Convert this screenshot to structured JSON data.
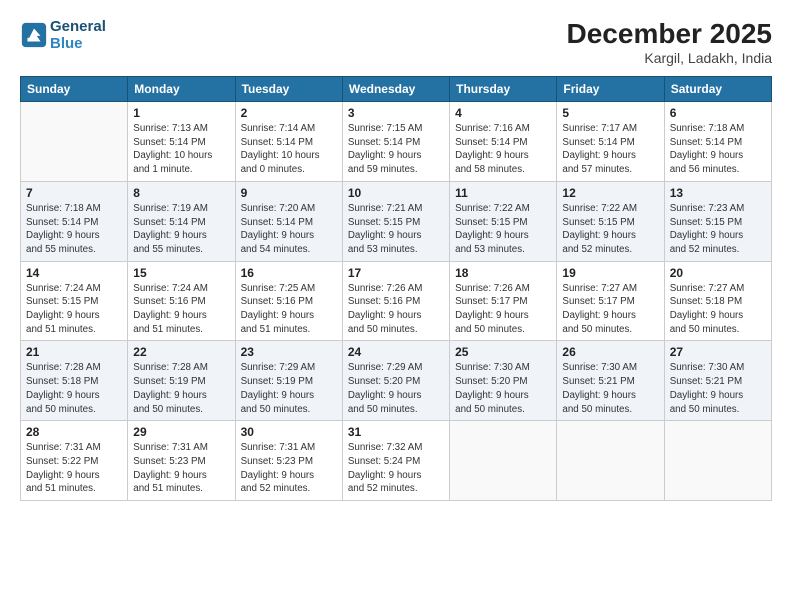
{
  "header": {
    "logo_line1": "General",
    "logo_line2": "Blue",
    "month_title": "December 2025",
    "location": "Kargil, Ladakh, India"
  },
  "weekdays": [
    "Sunday",
    "Monday",
    "Tuesday",
    "Wednesday",
    "Thursday",
    "Friday",
    "Saturday"
  ],
  "weeks": [
    [
      {
        "day": "",
        "info": ""
      },
      {
        "day": "1",
        "info": "Sunrise: 7:13 AM\nSunset: 5:14 PM\nDaylight: 10 hours\nand 1 minute."
      },
      {
        "day": "2",
        "info": "Sunrise: 7:14 AM\nSunset: 5:14 PM\nDaylight: 10 hours\nand 0 minutes."
      },
      {
        "day": "3",
        "info": "Sunrise: 7:15 AM\nSunset: 5:14 PM\nDaylight: 9 hours\nand 59 minutes."
      },
      {
        "day": "4",
        "info": "Sunrise: 7:16 AM\nSunset: 5:14 PM\nDaylight: 9 hours\nand 58 minutes."
      },
      {
        "day": "5",
        "info": "Sunrise: 7:17 AM\nSunset: 5:14 PM\nDaylight: 9 hours\nand 57 minutes."
      },
      {
        "day": "6",
        "info": "Sunrise: 7:18 AM\nSunset: 5:14 PM\nDaylight: 9 hours\nand 56 minutes."
      }
    ],
    [
      {
        "day": "7",
        "info": "Sunrise: 7:18 AM\nSunset: 5:14 PM\nDaylight: 9 hours\nand 55 minutes."
      },
      {
        "day": "8",
        "info": "Sunrise: 7:19 AM\nSunset: 5:14 PM\nDaylight: 9 hours\nand 55 minutes."
      },
      {
        "day": "9",
        "info": "Sunrise: 7:20 AM\nSunset: 5:14 PM\nDaylight: 9 hours\nand 54 minutes."
      },
      {
        "day": "10",
        "info": "Sunrise: 7:21 AM\nSunset: 5:15 PM\nDaylight: 9 hours\nand 53 minutes."
      },
      {
        "day": "11",
        "info": "Sunrise: 7:22 AM\nSunset: 5:15 PM\nDaylight: 9 hours\nand 53 minutes."
      },
      {
        "day": "12",
        "info": "Sunrise: 7:22 AM\nSunset: 5:15 PM\nDaylight: 9 hours\nand 52 minutes."
      },
      {
        "day": "13",
        "info": "Sunrise: 7:23 AM\nSunset: 5:15 PM\nDaylight: 9 hours\nand 52 minutes."
      }
    ],
    [
      {
        "day": "14",
        "info": "Sunrise: 7:24 AM\nSunset: 5:15 PM\nDaylight: 9 hours\nand 51 minutes."
      },
      {
        "day": "15",
        "info": "Sunrise: 7:24 AM\nSunset: 5:16 PM\nDaylight: 9 hours\nand 51 minutes."
      },
      {
        "day": "16",
        "info": "Sunrise: 7:25 AM\nSunset: 5:16 PM\nDaylight: 9 hours\nand 51 minutes."
      },
      {
        "day": "17",
        "info": "Sunrise: 7:26 AM\nSunset: 5:16 PM\nDaylight: 9 hours\nand 50 minutes."
      },
      {
        "day": "18",
        "info": "Sunrise: 7:26 AM\nSunset: 5:17 PM\nDaylight: 9 hours\nand 50 minutes."
      },
      {
        "day": "19",
        "info": "Sunrise: 7:27 AM\nSunset: 5:17 PM\nDaylight: 9 hours\nand 50 minutes."
      },
      {
        "day": "20",
        "info": "Sunrise: 7:27 AM\nSunset: 5:18 PM\nDaylight: 9 hours\nand 50 minutes."
      }
    ],
    [
      {
        "day": "21",
        "info": "Sunrise: 7:28 AM\nSunset: 5:18 PM\nDaylight: 9 hours\nand 50 minutes."
      },
      {
        "day": "22",
        "info": "Sunrise: 7:28 AM\nSunset: 5:19 PM\nDaylight: 9 hours\nand 50 minutes."
      },
      {
        "day": "23",
        "info": "Sunrise: 7:29 AM\nSunset: 5:19 PM\nDaylight: 9 hours\nand 50 minutes."
      },
      {
        "day": "24",
        "info": "Sunrise: 7:29 AM\nSunset: 5:20 PM\nDaylight: 9 hours\nand 50 minutes."
      },
      {
        "day": "25",
        "info": "Sunrise: 7:30 AM\nSunset: 5:20 PM\nDaylight: 9 hours\nand 50 minutes."
      },
      {
        "day": "26",
        "info": "Sunrise: 7:30 AM\nSunset: 5:21 PM\nDaylight: 9 hours\nand 50 minutes."
      },
      {
        "day": "27",
        "info": "Sunrise: 7:30 AM\nSunset: 5:21 PM\nDaylight: 9 hours\nand 50 minutes."
      }
    ],
    [
      {
        "day": "28",
        "info": "Sunrise: 7:31 AM\nSunset: 5:22 PM\nDaylight: 9 hours\nand 51 minutes."
      },
      {
        "day": "29",
        "info": "Sunrise: 7:31 AM\nSunset: 5:23 PM\nDaylight: 9 hours\nand 51 minutes."
      },
      {
        "day": "30",
        "info": "Sunrise: 7:31 AM\nSunset: 5:23 PM\nDaylight: 9 hours\nand 52 minutes."
      },
      {
        "day": "31",
        "info": "Sunrise: 7:32 AM\nSunset: 5:24 PM\nDaylight: 9 hours\nand 52 minutes."
      },
      {
        "day": "",
        "info": ""
      },
      {
        "day": "",
        "info": ""
      },
      {
        "day": "",
        "info": ""
      }
    ]
  ]
}
